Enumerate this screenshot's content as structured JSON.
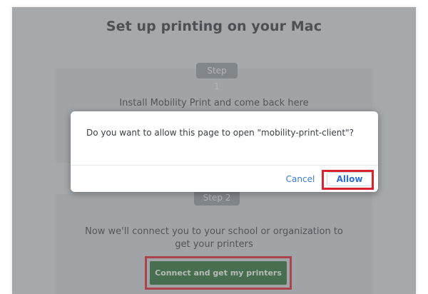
{
  "page": {
    "title": "Set up printing on your Mac"
  },
  "step1": {
    "badge": "Step 1",
    "text": "Install Mobility Print and come back here"
  },
  "step2": {
    "badge": "Step 2",
    "line1": "Now we'll connect you to your school or organization to",
    "line2": "get your printers",
    "button_label": "Connect and get my printers"
  },
  "dialog": {
    "message": "Do you want to allow this page to open \"mobility-print-client\"?",
    "cancel_label": "Cancel",
    "allow_label": "Allow"
  },
  "colors": {
    "button_green": "#2c6b33",
    "highlight_red": "#d8232f",
    "link_blue": "#3b7bd4"
  }
}
